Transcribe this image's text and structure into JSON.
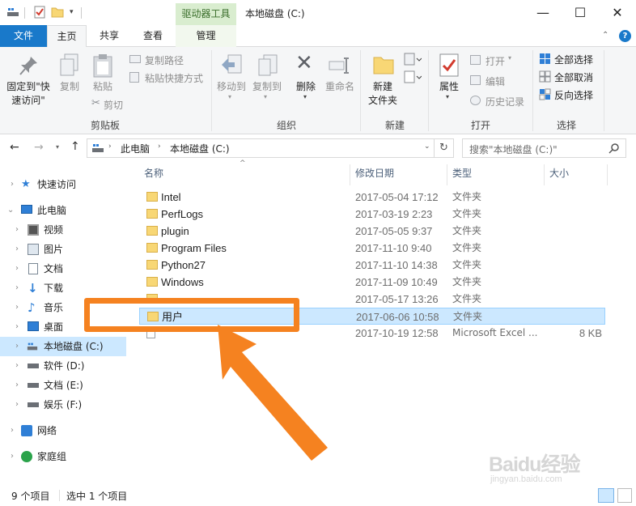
{
  "window": {
    "context_tab_title": "驱动器工具",
    "title": "本地磁盘 (C:)",
    "minimize": "—",
    "maximize": "☐",
    "close": "✕"
  },
  "tabs": {
    "file": "文件",
    "home": "主页",
    "share": "共享",
    "view": "查看",
    "manage": "管理"
  },
  "ribbon": {
    "clipboard": {
      "pin_line1": "固定到\"快",
      "pin_line2": "速访问\"",
      "copy": "复制",
      "paste": "粘贴",
      "copy_path": "复制路径",
      "paste_shortcut": "粘贴快捷方式",
      "cut": "剪切",
      "group": "剪贴板"
    },
    "organize": {
      "move_to": "移动到",
      "copy_to": "复制到",
      "delete": "删除",
      "rename": "重命名",
      "group": "组织"
    },
    "new": {
      "new_folder_line1": "新建",
      "new_folder_line2": "文件夹",
      "group": "新建"
    },
    "open": {
      "properties": "属性",
      "open": "打开",
      "edit": "编辑",
      "history": "历史记录",
      "group": "打开"
    },
    "select": {
      "select_all": "全部选择",
      "select_none": "全部取消",
      "invert": "反向选择",
      "group": "选择"
    }
  },
  "address": {
    "crumb1": "此电脑",
    "crumb2": "本地磁盘 (C:)",
    "search_placeholder": "搜索\"本地磁盘 (C:)\""
  },
  "nav": {
    "quick_access": "快速访问",
    "this_pc": "此电脑",
    "videos": "视频",
    "pictures": "图片",
    "documents": "文档",
    "downloads": "下载",
    "music": "音乐",
    "desktop": "桌面",
    "local_c": "本地磁盘 (C:)",
    "drive_d": "软件 (D:)",
    "drive_e": "文档 (E:)",
    "drive_f": "娱乐 (F:)",
    "network": "网络",
    "homegroup": "家庭组"
  },
  "columns": {
    "name": "名称",
    "modified": "修改日期",
    "type": "类型",
    "size": "大小"
  },
  "files": [
    {
      "name": "Intel",
      "date": "2017-05-04 17:12",
      "type": "文件夹",
      "size": ""
    },
    {
      "name": "PerfLogs",
      "date": "2017-03-19 2:23",
      "type": "文件夹",
      "size": ""
    },
    {
      "name": "plugin",
      "date": "2017-05-05 9:37",
      "type": "文件夹",
      "size": ""
    },
    {
      "name": "Program Files",
      "date": "2017-11-10 9:40",
      "type": "文件夹",
      "size": ""
    },
    {
      "name": "Python27",
      "date": "2017-11-10 14:38",
      "type": "文件夹",
      "size": ""
    },
    {
      "name": "Windows",
      "date": "2017-11-09 10:49",
      "type": "文件夹",
      "size": ""
    },
    {
      "name": "",
      "date": "2017-05-17 13:26",
      "type": "文件夹",
      "size": ""
    },
    {
      "name": "用户",
      "date": "2017-06-06 10:58",
      "type": "文件夹",
      "size": ""
    },
    {
      "name": "",
      "date": "2017-10-19 12:58",
      "type": "Microsoft Excel ...",
      "size": "8 KB"
    }
  ],
  "status": {
    "count": "9 个项目",
    "selected": "选中 1 个项目"
  },
  "watermark": {
    "brand": "Baidu经验",
    "url": "jingyan.baidu.com"
  },
  "colors": {
    "accent": "#1979ca",
    "selection": "#cce8ff",
    "highlight": "#f58220",
    "folder": "#f8d775"
  }
}
